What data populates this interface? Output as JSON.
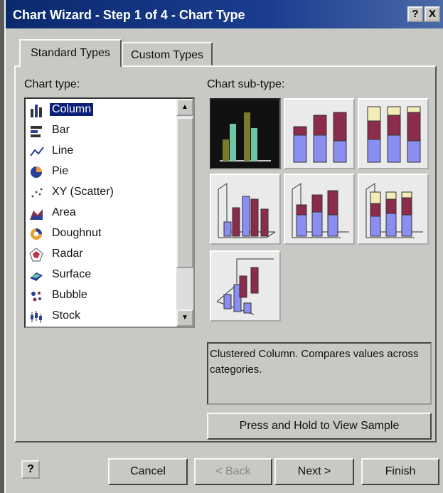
{
  "window": {
    "title": "Chart Wizard - Step 1 of 4 - Chart Type",
    "help_btn": "?",
    "close_btn": "X"
  },
  "tabs": [
    {
      "label": "Standard Types"
    },
    {
      "label": "Custom Types"
    }
  ],
  "chart_type": {
    "label": "Chart type:",
    "selected": "Column",
    "items": [
      {
        "label": "Column",
        "icon": "column-chart-icon"
      },
      {
        "label": "Bar",
        "icon": "bar-chart-icon"
      },
      {
        "label": "Line",
        "icon": "line-chart-icon"
      },
      {
        "label": "Pie",
        "icon": "pie-chart-icon"
      },
      {
        "label": "XY (Scatter)",
        "icon": "scatter-chart-icon"
      },
      {
        "label": "Area",
        "icon": "area-chart-icon"
      },
      {
        "label": "Doughnut",
        "icon": "doughnut-chart-icon"
      },
      {
        "label": "Radar",
        "icon": "radar-chart-icon"
      },
      {
        "label": "Surface",
        "icon": "surface-chart-icon"
      },
      {
        "label": "Bubble",
        "icon": "bubble-chart-icon"
      },
      {
        "label": "Stock",
        "icon": "stock-chart-icon"
      }
    ]
  },
  "chart_subtype": {
    "label": "Chart sub-type:",
    "selected_index": 0,
    "description": "Clustered Column. Compares values across categories."
  },
  "sample_button": "Press and Hold to View Sample",
  "footer": {
    "help": "?",
    "cancel": "Cancel",
    "back": "< Back",
    "next": "Next >",
    "finish": "Finish"
  },
  "colors": {
    "titlebar": "#0a2a6e",
    "selection": "#0a1f7a",
    "series_blue": "#8a8ef0",
    "series_maroon": "#8b2c4a",
    "series_cream": "#f2edb6",
    "dark_bar": "#7a7a2a",
    "teal_bar": "#6ec6a6"
  }
}
